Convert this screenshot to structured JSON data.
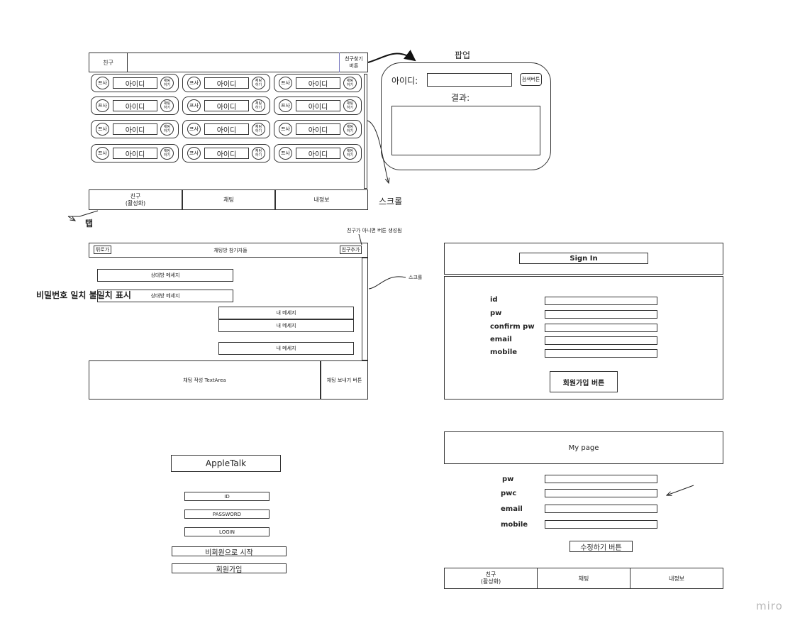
{
  "friends": {
    "title": "친구",
    "find_button": "친구찾기\n버튼",
    "grid": [
      [
        {
          "left": "프사",
          "id": "아이디",
          "right": "채팅\n하기"
        },
        {
          "left": "프사",
          "id": "아이디",
          "right": "채팅\n하기"
        },
        {
          "left": "프사",
          "id": "아이디",
          "right": "채팅\n하기"
        }
      ],
      [
        {
          "left": "프사",
          "id": "아이디",
          "right": "채팅\n하기"
        },
        {
          "left": "프사",
          "id": "아이디",
          "right": "채팅\n하기"
        },
        {
          "left": "프사",
          "id": "아이디",
          "right": "채팅\n하기"
        }
      ],
      [
        {
          "left": "프사",
          "id": "아이디",
          "right": "채팅\n하기"
        },
        {
          "left": "프사",
          "id": "아이디",
          "right": "채팅\n하기"
        },
        {
          "left": "프사",
          "id": "아이디",
          "right": "채팅\n하기"
        }
      ],
      [
        {
          "left": "프사",
          "id": "아이디",
          "right": "채팅\n하기"
        },
        {
          "left": "프사",
          "id": "아이디",
          "right": "채팅\n하기"
        },
        {
          "left": "프사",
          "id": "아이디",
          "right": "채팅\n하기"
        }
      ]
    ],
    "tabs": [
      "친구\n(활성화)",
      "채팅",
      "내정보"
    ]
  },
  "annotations": {
    "popup": "팝업",
    "scroll_big": "스크롤",
    "tab": "탭",
    "not_friend": "친구가 아니면 버튼 생성됨",
    "scroll_small": "스크롤",
    "password_mismatch": "비밀번호 일치 불일치 표시"
  },
  "popup": {
    "id_label": "아이디:",
    "search_button": "검색버튼",
    "result_label": "결과:"
  },
  "chat": {
    "back_button": "뒤로가",
    "participants": "채팅방 참가자들",
    "add_friend_button": "친구추가",
    "messages": [
      "상대방 메세지",
      "상대방 메세지",
      "내 메세지",
      "내 메세지",
      "내 메세지"
    ],
    "textarea": "채팅 작성 TextArea",
    "send_button": "채팅 보내기 버튼"
  },
  "signin": {
    "title": "Sign In",
    "fields": [
      "id",
      "pw",
      "confirm pw",
      "email",
      "mobile"
    ],
    "submit": "회원가입 버튼"
  },
  "login": {
    "app_name": "AppleTalk",
    "id": "ID",
    "password": "PASSWORD",
    "login": "LOGIN",
    "guest": "비회원으로 시작",
    "signup": "회원가입"
  },
  "mypage": {
    "title": "My page",
    "fields": [
      "pw",
      "pwc",
      "email",
      "mobile"
    ],
    "submit": "수정하기 버튼",
    "tabs": [
      "친구\n(활성화)",
      "채팅",
      "내정보"
    ]
  },
  "watermark": "miro"
}
